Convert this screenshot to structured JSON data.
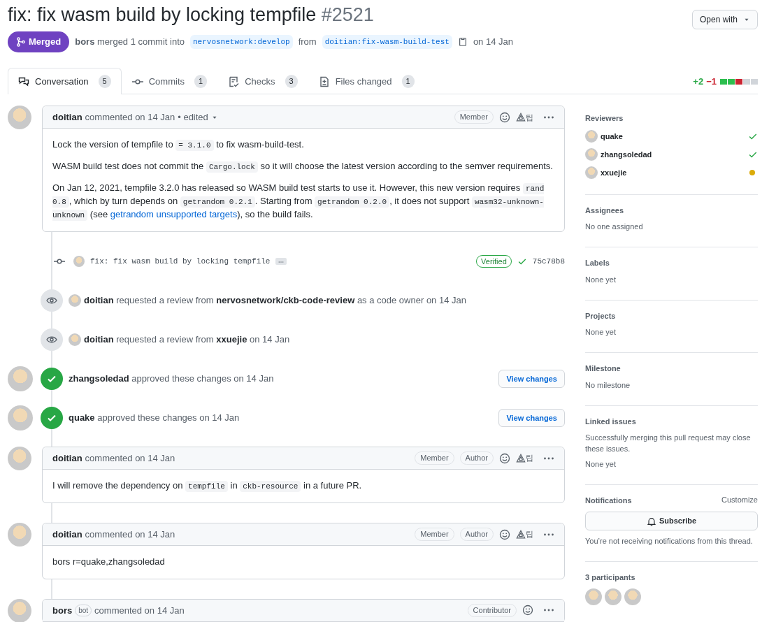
{
  "title": "fix: fix wasm build by locking tempfile",
  "number": "#2521",
  "open_with": "Open with",
  "state": {
    "label": "Merged",
    "kind": "merged"
  },
  "summary": {
    "actor": "bors",
    "text": "merged 1 commit into",
    "base": "nervosnetwork:develop",
    "from": "from",
    "head": "doitian:fix-wasm-build-test",
    "date": "on 14 Jan"
  },
  "tabs": [
    {
      "label": "Conversation",
      "count": "5",
      "kind": "conversation",
      "selected": true
    },
    {
      "label": "Commits",
      "count": "1",
      "kind": "commits",
      "selected": false
    },
    {
      "label": "Checks",
      "count": "3",
      "kind": "checks",
      "selected": false
    },
    {
      "label": "Files changed",
      "count": "1",
      "kind": "files",
      "selected": false
    }
  ],
  "diffstat": {
    "added": "+2",
    "removed": "−1",
    "blocks": [
      {
        "kind": "added"
      },
      {
        "kind": "added"
      },
      {
        "kind": "removed"
      },
      {
        "kind": "neutral"
      },
      {
        "kind": "neutral"
      }
    ]
  },
  "timeline": [
    {
      "kind": "comment",
      "author": "doitian",
      "meta": "commented on 14 Jan",
      "edited": "• edited",
      "labels": [
        "Member"
      ],
      "tip": "팁",
      "body": [
        [
          {
            "kind": "text",
            "text": "Lock the version of tempfile to "
          },
          {
            "kind": "code",
            "text": "= 3.1.0"
          },
          {
            "kind": "text",
            "text": " to fix wasm-build-test."
          }
        ],
        [
          {
            "kind": "text",
            "text": "WASM build test does not commit the "
          },
          {
            "kind": "code",
            "text": "Cargo.lock"
          },
          {
            "kind": "text",
            "text": " so it will choose the latest version according to the semver requirements."
          }
        ],
        [
          {
            "kind": "text",
            "text": "On Jan 12, 2021, tempfile 3.2.0 has released so WASM build test starts to use it. However, this new version requires "
          },
          {
            "kind": "code",
            "text": "rand 0.8"
          },
          {
            "kind": "text",
            "text": ", which by turn depends on "
          },
          {
            "kind": "code",
            "text": "getrandom 0.2.1"
          },
          {
            "kind": "text",
            "text": ". Starting from "
          },
          {
            "kind": "code",
            "text": "getrandom 0.2.0"
          },
          {
            "kind": "text",
            "text": ", it does not support "
          },
          {
            "kind": "code",
            "text": "wasm32-unknown-unknown"
          },
          {
            "kind": "text",
            "text": " (see "
          },
          {
            "kind": "link",
            "text": "getrandom unsupported targets"
          },
          {
            "kind": "text",
            "text": "), so the build fails."
          }
        ]
      ]
    },
    {
      "kind": "commit",
      "message": "fix: fix wasm build by locking tempfile",
      "verified": "Verified",
      "sha": "75c78b8"
    },
    {
      "kind": "review_request",
      "text": "**doitian** requested a review from **nervosnetwork/ckb-code-review** as a code owner on 14 Jan"
    },
    {
      "kind": "review_request",
      "text": "**doitian** requested a review from **xxuejie** on 14 Jan"
    },
    {
      "kind": "approval",
      "text": "**zhangsoledad** approved these changes on 14 Jan",
      "button": "View changes"
    },
    {
      "kind": "approval",
      "text": "**quake** approved these changes on 14 Jan",
      "button": "View changes"
    },
    {
      "kind": "comment",
      "author": "doitian",
      "meta": "commented on 14 Jan",
      "labels": [
        "Member",
        "Author"
      ],
      "tip": "팁",
      "body": [
        [
          {
            "kind": "text",
            "text": "I will remove the dependency on "
          },
          {
            "kind": "code",
            "text": "tempfile"
          },
          {
            "kind": "text",
            "text": " in "
          },
          {
            "kind": "code",
            "text": "ckb-resource"
          },
          {
            "kind": "text",
            "text": " in a future PR."
          }
        ]
      ]
    },
    {
      "kind": "comment",
      "author": "doitian",
      "meta": "commented on 14 Jan",
      "labels": [
        "Member",
        "Author"
      ],
      "tip": "팁",
      "body": [
        [
          {
            "kind": "text",
            "text": "bors r=quake,zhangsoledad"
          }
        ]
      ]
    },
    {
      "kind": "comment",
      "author": "bors",
      "bot": "bot",
      "meta": "commented on 14 Jan",
      "labels": [
        "Contributor"
      ]
    }
  ],
  "sidebar": {
    "reviewers": {
      "title": "Reviewers",
      "items": [
        {
          "name": "quake",
          "kind": "approved"
        },
        {
          "name": "zhangsoledad",
          "kind": "approved"
        },
        {
          "name": "xxuejie",
          "kind": "pending"
        }
      ]
    },
    "sections": [
      {
        "title": "Assignees",
        "lines": [
          "No one assigned"
        ]
      },
      {
        "title": "Labels",
        "lines": [
          "None yet"
        ]
      },
      {
        "title": "Projects",
        "lines": [
          "None yet"
        ]
      },
      {
        "title": "Milestone",
        "lines": [
          "No milestone"
        ]
      },
      {
        "title": "Linked issues",
        "lines": [
          "Successfully merging this pull request may close these issues.",
          "None yet"
        ]
      }
    ],
    "notifications": {
      "title": "Notifications",
      "action": "Customize",
      "button": "Subscribe",
      "note": "You’re not receiving notifications from this thread."
    },
    "participants": {
      "title": "3 participants"
    }
  }
}
